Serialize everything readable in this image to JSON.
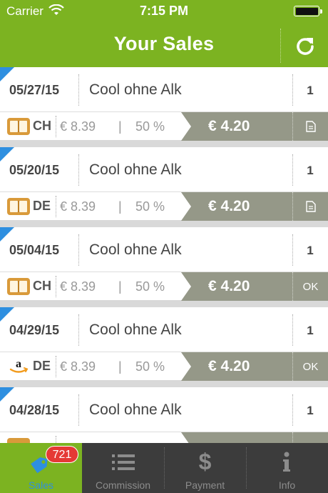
{
  "status_bar": {
    "carrier": "Carrier",
    "time": "7:15 PM"
  },
  "nav": {
    "title": "Your Sales",
    "refresh_icon": "refresh-icon"
  },
  "sales": [
    {
      "date": "05/27/15",
      "name": "Cool ohne Alk",
      "quantity": "1",
      "store": "ibooks",
      "country": "CH",
      "price": "€ 8.39",
      "separator": "|",
      "percent": "50 %",
      "earnings": "€ 4.20",
      "status": "document"
    },
    {
      "date": "05/20/15",
      "name": "Cool ohne Alk",
      "quantity": "1",
      "store": "ibooks",
      "country": "DE",
      "price": "€ 8.39",
      "separator": "|",
      "percent": "50 %",
      "earnings": "€ 4.20",
      "status": "document"
    },
    {
      "date": "05/04/15",
      "name": "Cool ohne Alk",
      "quantity": "1",
      "store": "ibooks",
      "country": "CH",
      "price": "€ 8.39",
      "separator": "|",
      "percent": "50 %",
      "earnings": "€ 4.20",
      "status": "OK"
    },
    {
      "date": "04/29/15",
      "name": "Cool ohne Alk",
      "quantity": "1",
      "store": "amazon",
      "country": "DE",
      "price": "€ 8.39",
      "separator": "|",
      "percent": "50 %",
      "earnings": "€ 4.20",
      "status": "OK"
    },
    {
      "date": "04/28/15",
      "name": "Cool ohne Alk",
      "quantity": "1",
      "store": "ibooks",
      "country": "",
      "price": "",
      "separator": "",
      "percent": "",
      "earnings": "",
      "status": ""
    }
  ],
  "tabs": [
    {
      "label": "Sales",
      "icon": "tag-icon",
      "badge": "721",
      "active": true
    },
    {
      "label": "Commission",
      "icon": "list-icon",
      "active": false
    },
    {
      "label": "Payment",
      "icon": "dollar-icon",
      "active": false
    },
    {
      "label": "Info",
      "icon": "info-icon",
      "active": false
    }
  ],
  "colors": {
    "brand_green": "#7cb321",
    "accent_blue": "#2e8fe0",
    "earnings_gray": "#959888",
    "badge_red": "#e53935"
  }
}
